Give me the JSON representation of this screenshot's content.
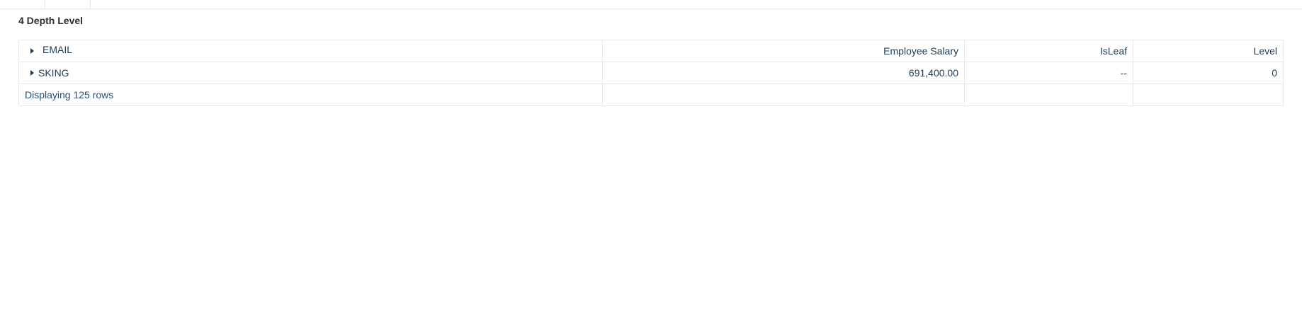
{
  "section": {
    "title": "4 Depth Level"
  },
  "table": {
    "header": {
      "group_label": "EMAIL",
      "columns": [
        "Employee Salary",
        "IsLeaf",
        "Level"
      ]
    },
    "rows": [
      {
        "label": "SKING",
        "employee_salary": "691,400.00",
        "is_leaf": "--",
        "level": "0"
      }
    ],
    "footer": {
      "status": "Displaying 125 rows"
    }
  }
}
